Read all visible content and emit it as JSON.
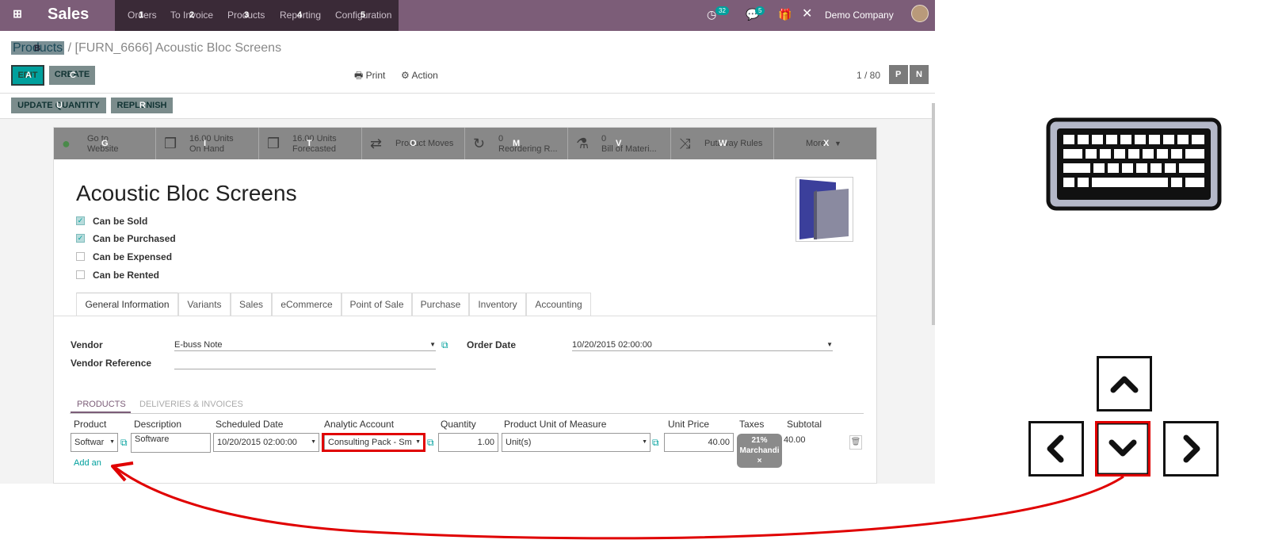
{
  "navbar": {
    "app_title": "Sales",
    "menu": [
      {
        "label": "Orders",
        "hint": "1"
      },
      {
        "label": "To Invoice",
        "hint": "2"
      },
      {
        "label": "Products",
        "hint": "3"
      },
      {
        "label": "Reporting",
        "hint": "4"
      },
      {
        "label": "Configuration",
        "hint": "5"
      }
    ],
    "activity_count": "32",
    "messages_count": "5",
    "company": "Demo Company",
    "accent_color": "#7c5d78"
  },
  "control_panel": {
    "breadcrumb_root": "Products",
    "breadcrumb_root_hint": "B",
    "breadcrumb_sep": "/",
    "breadcrumb_current": "[FURN_6666] Acoustic Bloc Screens",
    "edit_label": "EDIT",
    "edit_hint": "A",
    "create_label": "CREATE",
    "create_hint": "C",
    "print_label": "Print",
    "action_label": "Action",
    "pager_value": "1 / 80",
    "pager_prev": "P",
    "pager_next": "N"
  },
  "statusbar": {
    "update_qty_label": "UPDATE QUANTITY",
    "update_qty_hint": "U",
    "replenish_label": "REPLENISH",
    "replenish_hint": "R"
  },
  "smart_buttons": [
    {
      "line1": "Go to",
      "line2": "Website",
      "hint": "G",
      "icon": "globe-icon"
    },
    {
      "line1": "16.00 Units",
      "line2": "On Hand",
      "hint": "I",
      "icon": "cubes-icon"
    },
    {
      "line1": "16.00 Units",
      "line2": "Forecasted",
      "hint": "T",
      "icon": "cubes-icon"
    },
    {
      "line1": "Product Moves",
      "line2": "",
      "hint": "O",
      "icon": "exchange-icon"
    },
    {
      "line1": "0",
      "line2": "Reordering R...",
      "hint": "M",
      "icon": "refresh-icon"
    },
    {
      "line1": "0",
      "line2": "Bill of Materi...",
      "hint": "V",
      "icon": "flask-icon"
    },
    {
      "line1": "Putaway Rules",
      "line2": "",
      "hint": "W",
      "icon": "random-icon"
    },
    {
      "line1": "More",
      "line2": "",
      "hint": "X",
      "icon": "caret-down-icon"
    }
  ],
  "product": {
    "name": "Acoustic Bloc Screens",
    "checkboxes": [
      {
        "label": "Can be Sold",
        "checked": true
      },
      {
        "label": "Can be Purchased",
        "checked": true
      },
      {
        "label": "Can be Expensed",
        "checked": false
      },
      {
        "label": "Can be Rented",
        "checked": false
      }
    ]
  },
  "tabs": [
    "General Information",
    "Variants",
    "Sales",
    "eCommerce",
    "Point of Sale",
    "Purchase",
    "Inventory",
    "Accounting"
  ],
  "purchase_form": {
    "vendor_label": "Vendor",
    "vendor_value": "E-buss Note",
    "vendor_ref_label": "Vendor Reference",
    "order_date_label": "Order Date",
    "order_date_value": "10/20/2015 02:00:00"
  },
  "subtabs": [
    "PRODUCTS",
    "DELIVERIES & INVOICES"
  ],
  "lines_table": {
    "headers": [
      "Product",
      "Description",
      "Scheduled Date",
      "Analytic Account",
      "Quantity",
      "Product Unit of Measure",
      "Unit Price",
      "Taxes",
      "Subtotal"
    ],
    "row": {
      "product": "Softwar",
      "description": "Software",
      "scheduled_date": "10/20/2015 02:00:00",
      "analytic_account": "Consulting Pack - Sm",
      "quantity": "1.00",
      "uom": "Unit(s)",
      "unit_price": "40.00",
      "tax_line1": "21%",
      "tax_line2": "Marchandi",
      "tax_remove": "×",
      "subtotal": "40.00"
    },
    "add_line_label": "Add an"
  },
  "highlight_color": "#e00000"
}
